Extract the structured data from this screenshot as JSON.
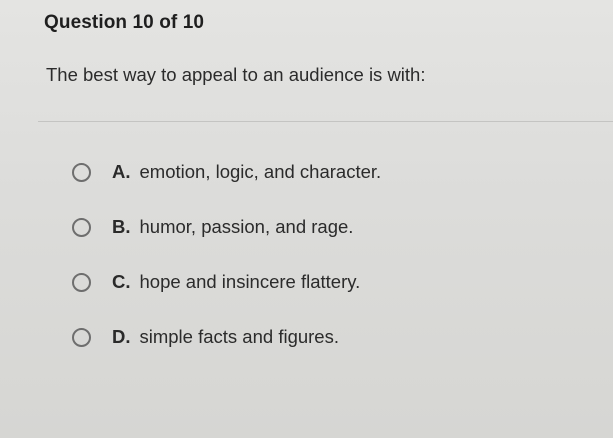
{
  "question": {
    "header": "Question 10 of 10",
    "prompt": "The best way to appeal to an audience is with:"
  },
  "options": [
    {
      "letter": "A.",
      "text": "emotion, logic, and character.",
      "selected": false
    },
    {
      "letter": "B.",
      "text": "humor, passion, and rage.",
      "selected": false
    },
    {
      "letter": "C.",
      "text": "hope and insincere flattery.",
      "selected": false
    },
    {
      "letter": "D.",
      "text": "simple facts and figures.",
      "selected": false
    }
  ],
  "colors": {
    "background": "#dcdcda",
    "text": "#2b2b2b",
    "radio_border": "#6e6e6e"
  },
  "icons": {
    "radio": "radio-unchecked-icon"
  }
}
